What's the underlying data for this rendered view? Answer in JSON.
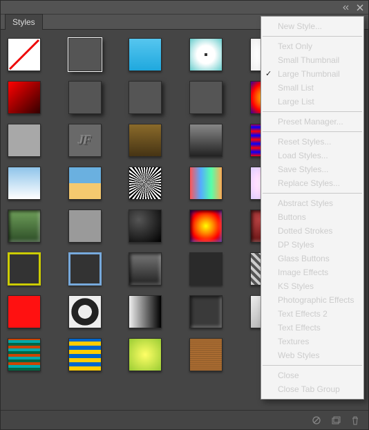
{
  "tabs": [
    "Styles"
  ],
  "menu": [
    {
      "label": "New Style...",
      "disabled": true
    },
    {
      "sep": true
    },
    {
      "label": "Text Only"
    },
    {
      "label": "Small Thumbnail"
    },
    {
      "label": "Large Thumbnail",
      "checked": true
    },
    {
      "label": "Small List"
    },
    {
      "label": "Large List"
    },
    {
      "sep": true
    },
    {
      "label": "Preset Manager..."
    },
    {
      "sep": true
    },
    {
      "label": "Reset Styles..."
    },
    {
      "label": "Load Styles..."
    },
    {
      "label": "Save Styles..."
    },
    {
      "label": "Replace Styles..."
    },
    {
      "sep": true
    },
    {
      "label": "Abstract Styles"
    },
    {
      "label": "Buttons"
    },
    {
      "label": "Dotted Strokes"
    },
    {
      "label": "DP Styles"
    },
    {
      "label": "Glass Buttons"
    },
    {
      "label": "Image Effects"
    },
    {
      "label": "KS Styles"
    },
    {
      "label": "Photographic Effects"
    },
    {
      "label": "Text Effects 2"
    },
    {
      "label": "Text Effects"
    },
    {
      "label": "Textures"
    },
    {
      "label": "Web Styles"
    },
    {
      "sep": true
    },
    {
      "label": "Close"
    },
    {
      "label": "Close Tab Group"
    }
  ],
  "tiles": [
    {
      "bg": "#fff",
      "slash": true
    },
    {
      "bg": "#555",
      "sel": true,
      "shadow": true
    },
    {
      "bg": "linear-gradient(#56c6ef,#1fa8de)"
    },
    {
      "bg": "radial-gradient(circle,#fff 40%,#6cc)",
      "dot": true
    },
    {
      "bg": "radial-gradient(circle,#fff 40%,#eee)",
      "dot": true
    },
    {
      "bg": "linear-gradient(90deg,red,orange,yellow,green,blue,violet)"
    },
    {
      "bg": "linear-gradient(135deg,#f00,#300)"
    },
    {
      "bg": "#555",
      "shadow": true
    },
    {
      "bg": "#555",
      "shadow": true
    },
    {
      "bg": "#555",
      "shadow": true
    },
    {
      "bg": "radial-gradient(circle,#ff0,#f80,#f00,#309)"
    },
    {
      "bg": "#555",
      "border": "double 4px #ffe680"
    },
    {
      "bg": "#a8a8a8"
    },
    {
      "bg": "#696969",
      "emboss": "JF"
    },
    {
      "bg": "linear-gradient(#8a6a2a,#463414)"
    },
    {
      "bg": "linear-gradient(#888,#222)"
    },
    {
      "bg": "repeating-linear-gradient(0deg,#f00,#00f 6px,#f00 12px)"
    },
    {
      "bg": "conic-gradient(#ff0,#f0f,#0ff,#ff0)"
    },
    {
      "bg": "linear-gradient(#8fc4ea,#fff)"
    },
    {
      "bg": "linear-gradient(#6ab0e0 50%,#f5c96f 50%)"
    },
    {
      "bg": "repeating-conic-gradient(#000 0 5deg,#fff 5deg 10deg)"
    },
    {
      "bg": "linear-gradient(90deg,#f55,#5af,#5fa,#fa5)"
    },
    {
      "bg": "radial-gradient(circle,#fff,#fdf,#dcf)"
    },
    {
      "bg": "linear-gradient(#444,#000)"
    },
    {
      "bg": "linear-gradient(#6fa05a,#2d4d27)",
      "inset": true
    },
    {
      "bg": "#9a9a9a",
      "rough": true
    },
    {
      "bg": "radial-gradient(circle at 30% 30%,#555,#000)"
    },
    {
      "bg": "radial-gradient(circle,#ff0,#f80,#f00,#309)",
      "inset": true
    },
    {
      "bg": "radial-gradient(circle at 30% 30%,#b44,#400)",
      "inset": true
    },
    {
      "bg": "linear-gradient(#d0d0d0,#888)",
      "rough": true
    },
    {
      "bg": "#333",
      "border": "3px solid #cc0"
    },
    {
      "bg": "#333",
      "border": "3px solid #7ad"
    },
    {
      "bg": "linear-gradient(#777,#222)",
      "inset": true
    },
    {
      "bg": "#2a2a2a"
    },
    {
      "bg": "repeating-linear-gradient(45deg,#ccc 0 4px,#555 4px 8px)"
    },
    {
      "bg": "linear-gradient(90deg,#f36,#fc3,#3cf)"
    },
    {
      "bg": "#f11"
    },
    {
      "bg": "radial-gradient(circle at 50% 50%,#eee 0 30%,#222 31% 60%,#eee 61%)"
    },
    {
      "bg": "linear-gradient(90deg,#eee,#000)"
    },
    {
      "bg": "#3a3a3a",
      "inset": true
    },
    {
      "bg": "linear-gradient(135deg,#eee,#999)",
      "rough": true
    },
    {
      "bg": "linear-gradient(#eee,#aaa)",
      "rounded": true
    },
    {
      "bg": "repeating-linear-gradient(0deg,#064,#064 4px,#0aa 4px,#0aa 8px,#c40 8px,#c40 12px)"
    },
    {
      "bg": "repeating-linear-gradient(0deg,#fc0,#fc0 6px,#06c 6px,#06c 12px)"
    },
    {
      "bg": "radial-gradient(circle,#ff6,#9c3)"
    },
    {
      "bg": "repeating-linear-gradient(0deg,#b87333,#8b5a2b 3px)"
    }
  ]
}
